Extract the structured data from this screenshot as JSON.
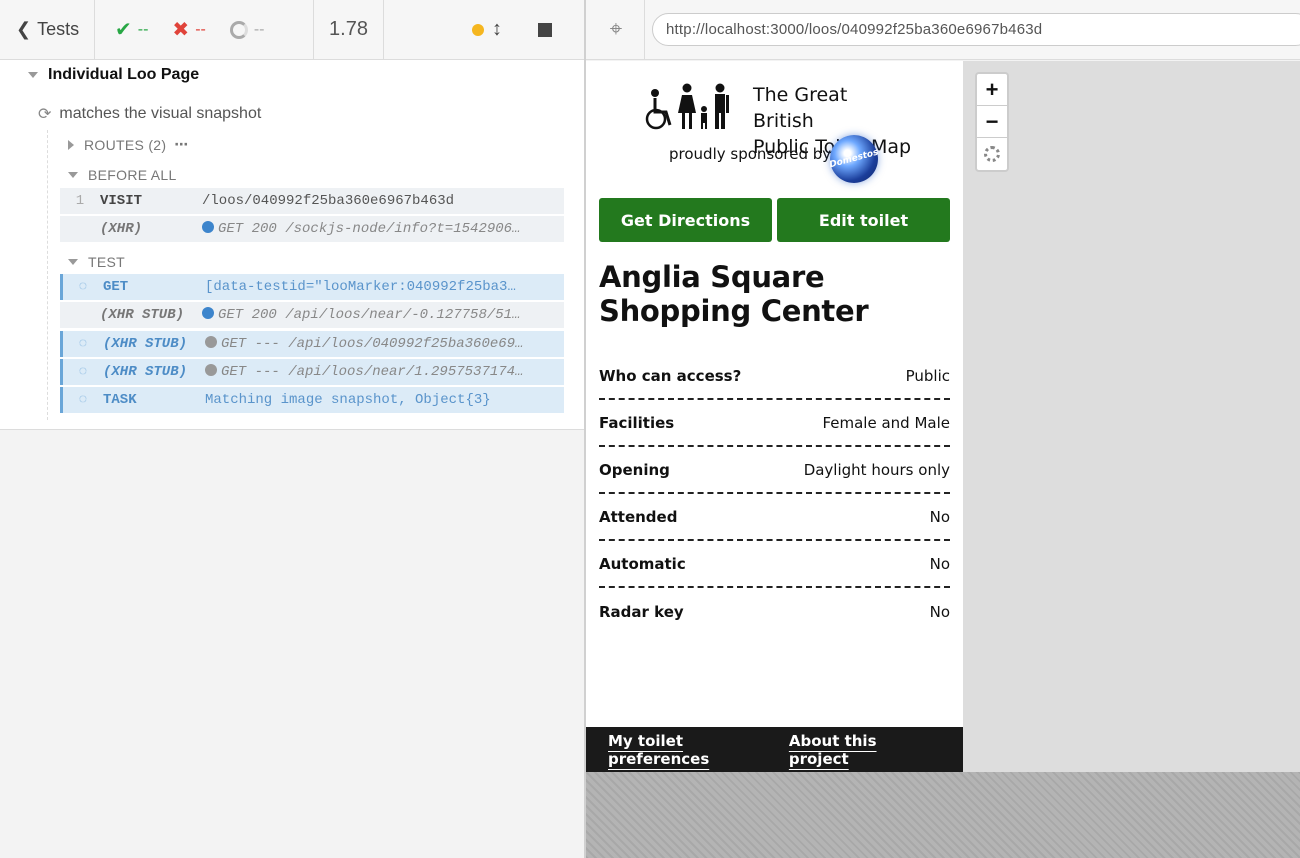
{
  "reporter_header": {
    "tests_label": "Tests",
    "passed": "--",
    "failed": "--",
    "pending": "--",
    "duration": "1.78"
  },
  "command_log": {
    "suite_title": "Individual Loo Page",
    "test_title": "matches the visual snapshot",
    "routes_label": "ROUTES (2)",
    "before_all_label": "BEFORE ALL",
    "test_label": "TEST",
    "before_all_commands": [
      {
        "num": "1",
        "name": "VISIT",
        "message": "/loos/040992f25ba360e6967b463d"
      },
      {
        "num": "",
        "name": "(XHR)",
        "message": "GET 200 /sockjs-node/info?t=1542906…"
      }
    ],
    "test_commands": [
      {
        "name": "GET",
        "message": "[data-testid=\"looMarker:040992f25ba3…"
      },
      {
        "name": "(XHR STUB)",
        "message": "GET 200 /api/loos/near/-0.127758/51…"
      },
      {
        "name": "(XHR STUB)",
        "message": "GET --- /api/loos/040992f25ba360e69…"
      },
      {
        "name": "(XHR STUB)",
        "message": "GET --- /api/loos/near/1.2957537174…"
      },
      {
        "name": "TASK",
        "message": "Matching image snapshot, Object{3}"
      }
    ]
  },
  "aut_header": {
    "url": "http://localhost:3000/loos/040992f25ba360e6967b463d"
  },
  "app": {
    "logo_title_line1": "The Great British",
    "logo_title_line2": "Public Toilet Map",
    "sponsor_text": "proudly sponsored by",
    "sponsor_logo_text": "Domestos",
    "get_directions": "Get Directions",
    "edit_toilet": "Edit toilet",
    "loo_name": "Anglia Square Shopping Center",
    "properties": [
      {
        "key": "Who can access?",
        "value": "Public"
      },
      {
        "key": "Facilities",
        "value": "Female and Male"
      },
      {
        "key": "Opening",
        "value": "Daylight hours only"
      },
      {
        "key": "Attended",
        "value": "No"
      },
      {
        "key": "Automatic",
        "value": "No"
      },
      {
        "key": "Radar key",
        "value": "No"
      }
    ],
    "footer_links": [
      "My toilet preferences",
      "About this project"
    ],
    "map_zoom_in": "+",
    "map_zoom_out": "−"
  },
  "colors": {
    "primary_green": "#23791e",
    "pending_blue": "#6aa6d8",
    "pass_green": "#28a745",
    "fail_red": "#e0433a",
    "running_yellow": "#f5b61f"
  }
}
